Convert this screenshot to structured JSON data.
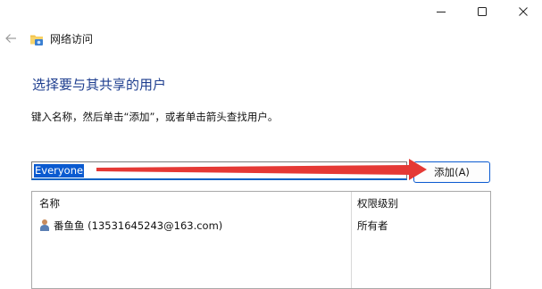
{
  "window": {
    "controls": [
      "minimize-icon",
      "maximize-icon",
      "close-icon"
    ]
  },
  "nav": {
    "back_icon": "arrow-left-icon",
    "app_icon": "network-folder-icon",
    "title": "网络访问"
  },
  "main": {
    "heading": "选择要与其共享的用户",
    "instructions": "键入名称，然后单击“添加”，或者单击箭头查找用户。",
    "name_input_value": "Everyone",
    "add_button_label": "添加(A)",
    "annotation_arrow_color": "#e53935",
    "accent_color": "#0a5ad0",
    "heading_color": "#1e3e8f"
  },
  "table": {
    "columns": [
      "名称",
      "权限级别"
    ],
    "rows": [
      {
        "icon": "user-icon",
        "name": "番鱼鱼 (13531645243@163.com)",
        "permission": "所有者"
      }
    ]
  }
}
